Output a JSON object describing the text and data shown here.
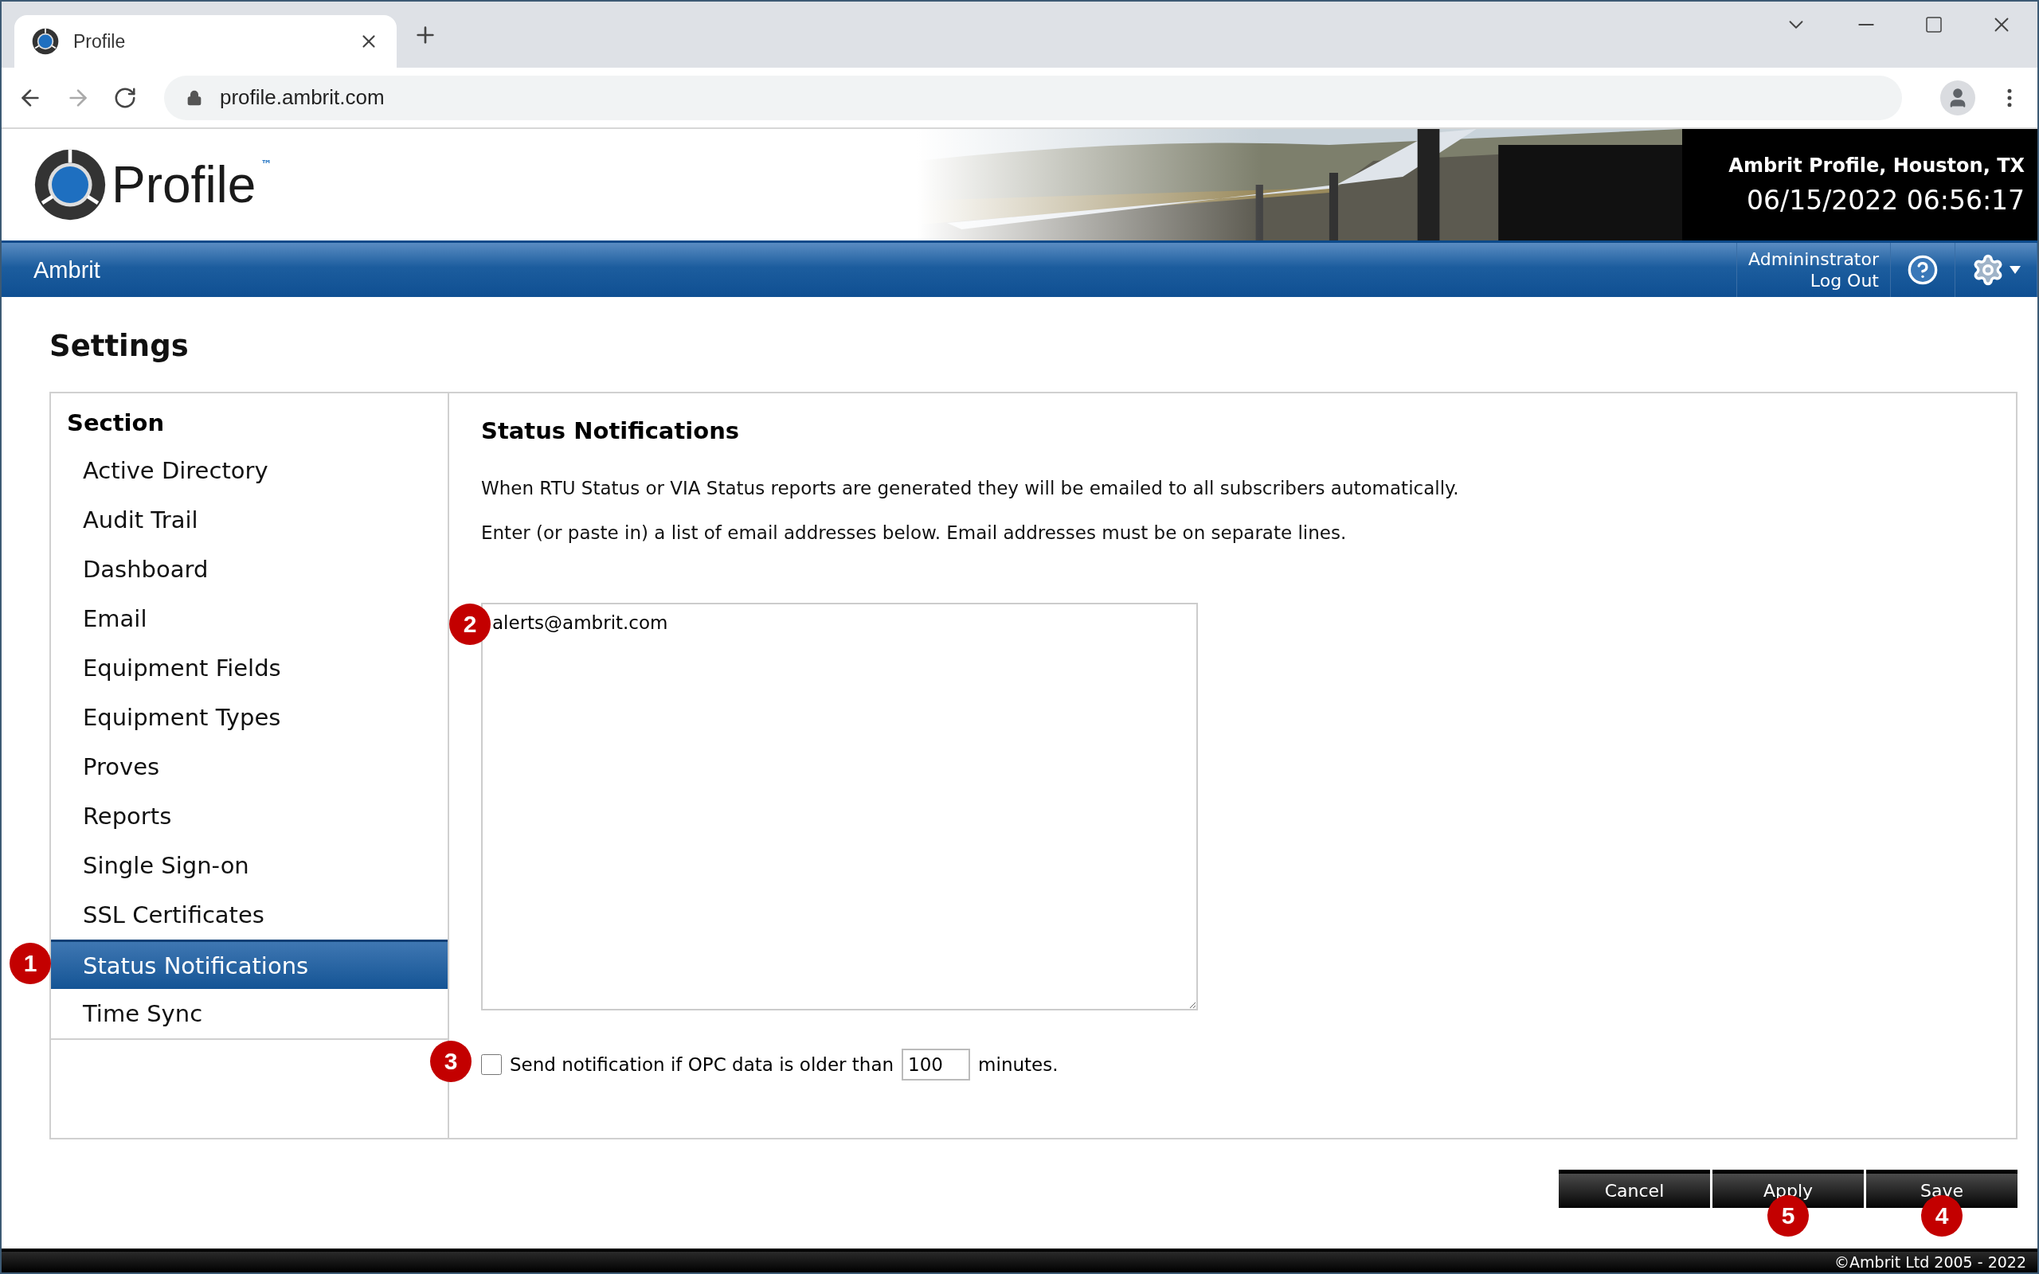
{
  "browser": {
    "tab": {
      "title": "Profile"
    },
    "url": "profile.ambrit.com"
  },
  "header": {
    "logo_text": "Profile",
    "logo_mark": "™",
    "site": "Ambrit Profile, Houston, TX",
    "datetime": "06/15/2022 06:56:17"
  },
  "nav": {
    "title": "Ambrit",
    "user": "Admininstrator",
    "logout": "Log Out"
  },
  "page": {
    "title": "Settings"
  },
  "sidebar": {
    "heading": "Section",
    "items": [
      {
        "label": "Active Directory",
        "selected": false
      },
      {
        "label": "Audit Trail",
        "selected": false
      },
      {
        "label": "Dashboard",
        "selected": false
      },
      {
        "label": "Email",
        "selected": false
      },
      {
        "label": "Equipment Fields",
        "selected": false
      },
      {
        "label": "Equipment Types",
        "selected": false
      },
      {
        "label": "Proves",
        "selected": false
      },
      {
        "label": "Reports",
        "selected": false
      },
      {
        "label": "Single Sign-on",
        "selected": false
      },
      {
        "label": "SSL Certificates",
        "selected": false
      },
      {
        "label": "Status Notifications",
        "selected": true,
        "callout": "1"
      },
      {
        "label": "Time Sync",
        "selected": false
      }
    ]
  },
  "panel": {
    "title": "Status Notifications",
    "paragraphs": [
      "When RTU Status or VIA Status reports are generated they will be emailed to all subscribers automatically.",
      "Enter (or paste in) a list of email addresses below. Email addresses must be on separate lines."
    ],
    "email_list": {
      "value": "alerts@ambrit.com",
      "callout": "2"
    },
    "opc_option": {
      "checked": false,
      "label": "Send notification if OPC data is older than",
      "minutes": "100",
      "unit": "minutes.",
      "callout": "3"
    }
  },
  "buttons": [
    {
      "label": "Cancel"
    },
    {
      "label": "Apply",
      "callout": "5"
    },
    {
      "label": "Save",
      "callout": "4"
    }
  ],
  "footer": "©Ambrit Ltd 2005 - 2022"
}
